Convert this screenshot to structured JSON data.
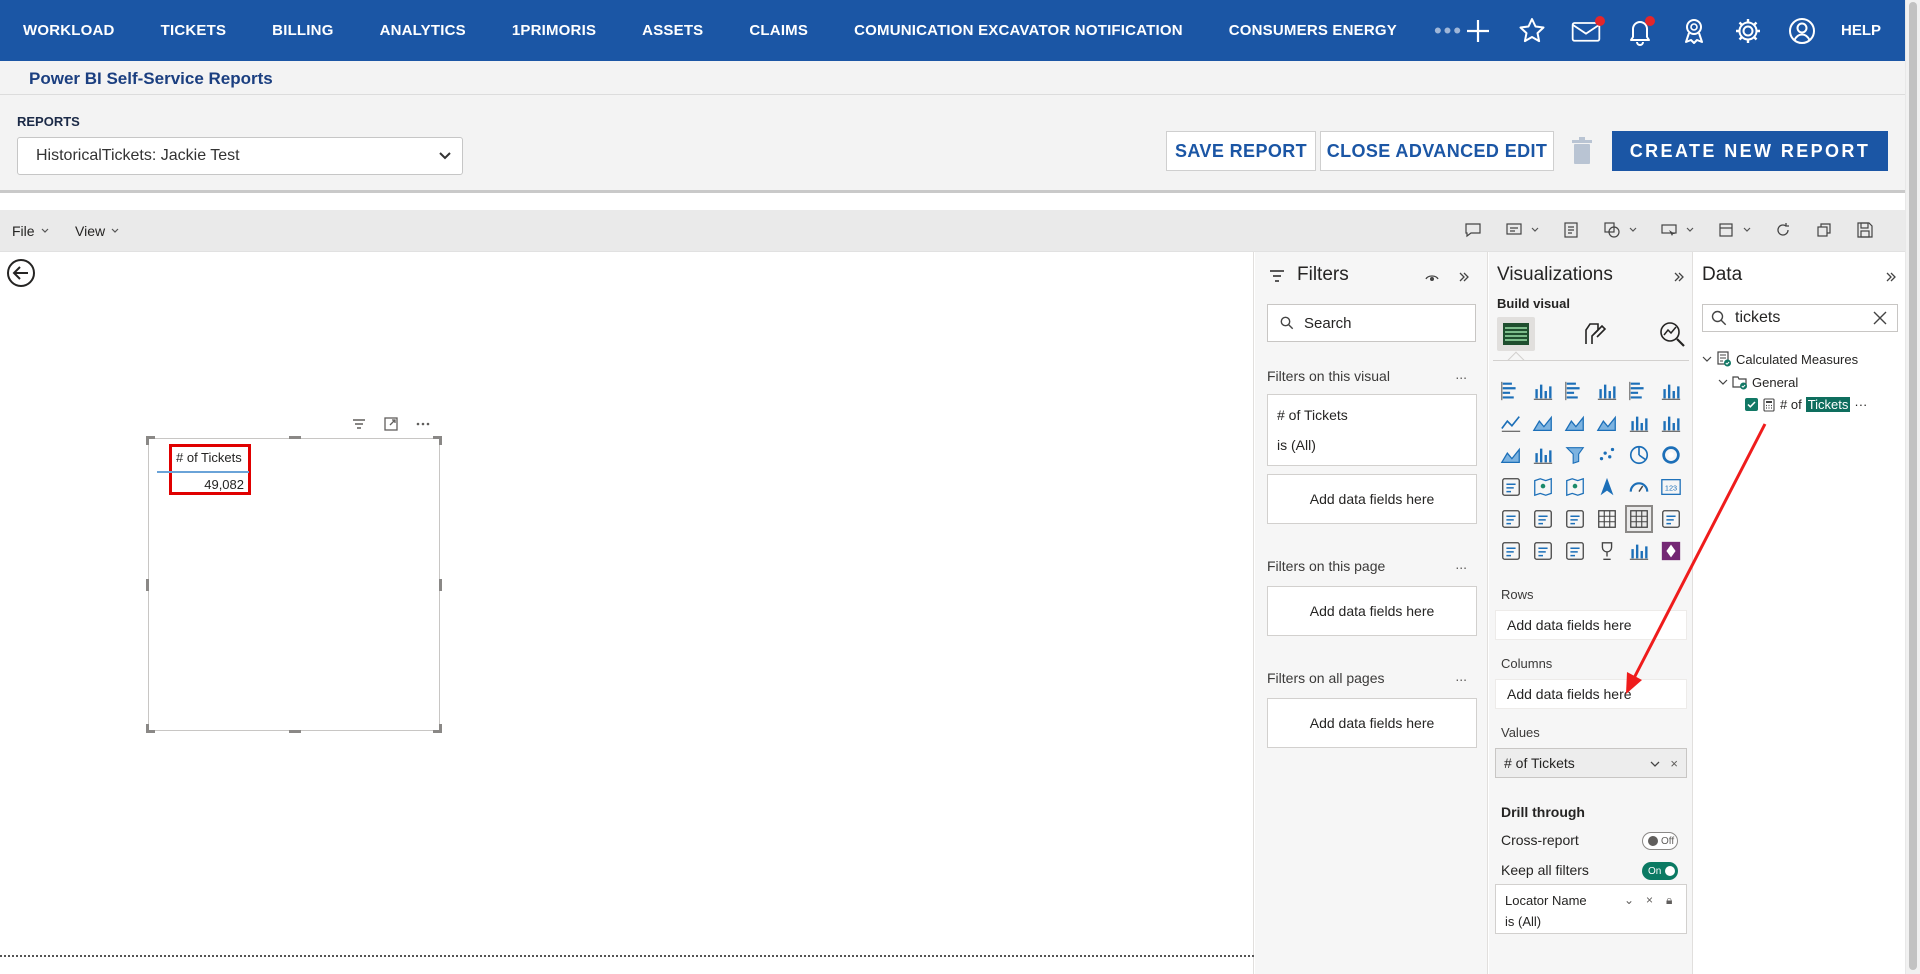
{
  "nav": {
    "items": [
      "WORKLOAD",
      "TICKETS",
      "BILLING",
      "ANALYTICS",
      "1PRIMORIS",
      "ASSETS",
      "CLAIMS",
      "COMUNICATION EXCAVATOR NOTIFICATION",
      "CONSUMERS ENERGY"
    ],
    "more": "•••",
    "help": "HELP",
    "icons": [
      "plus-icon",
      "star-icon",
      "messages-icon",
      "bell-icon",
      "award-icon",
      "gear-icon",
      "user-icon"
    ],
    "brand_color": "#1b56a5",
    "alert_color": "#e3262b"
  },
  "subheader": {
    "title": "Power BI Self-Service Reports"
  },
  "reports": {
    "label": "REPORTS",
    "selected": "HistoricalTickets: Jackie Test",
    "save_label": "SAVE REPORT",
    "close_label": "CLOSE ADVANCED EDIT",
    "create_label": "CREATE NEW REPORT"
  },
  "pbi_menu": {
    "file": "File",
    "view": "View"
  },
  "canvas": {
    "visual": {
      "header": "# of Tickets",
      "value": "49,082"
    }
  },
  "filters": {
    "title": "Filters",
    "search_placeholder": "Search",
    "on_visual": "Filters on this visual",
    "on_page": "Filters on this page",
    "on_all": "Filters on all pages",
    "ellipsis": "...",
    "card_name": "# of Tickets",
    "card_value": "is (All)",
    "drop_label": "Add data fields here"
  },
  "viz": {
    "title": "Visualizations",
    "build": "Build visual",
    "rows": "Rows",
    "columns": "Columns",
    "values": "Values",
    "drop_label": "Add data fields here",
    "value_field": "# of Tickets",
    "drill": "Drill through",
    "cross_report": "Cross-report",
    "cross_state": "Off",
    "keep_filters": "Keep all filters",
    "keep_state": "On",
    "drill_field": "Locator Name",
    "drill_value": "is (All)"
  },
  "data": {
    "title": "Data",
    "search_value": "tickets",
    "table": "Calculated Measures",
    "folder": "General",
    "field_prefix": "# of",
    "field_highlight": "Tickets",
    "field_more": "···"
  }
}
